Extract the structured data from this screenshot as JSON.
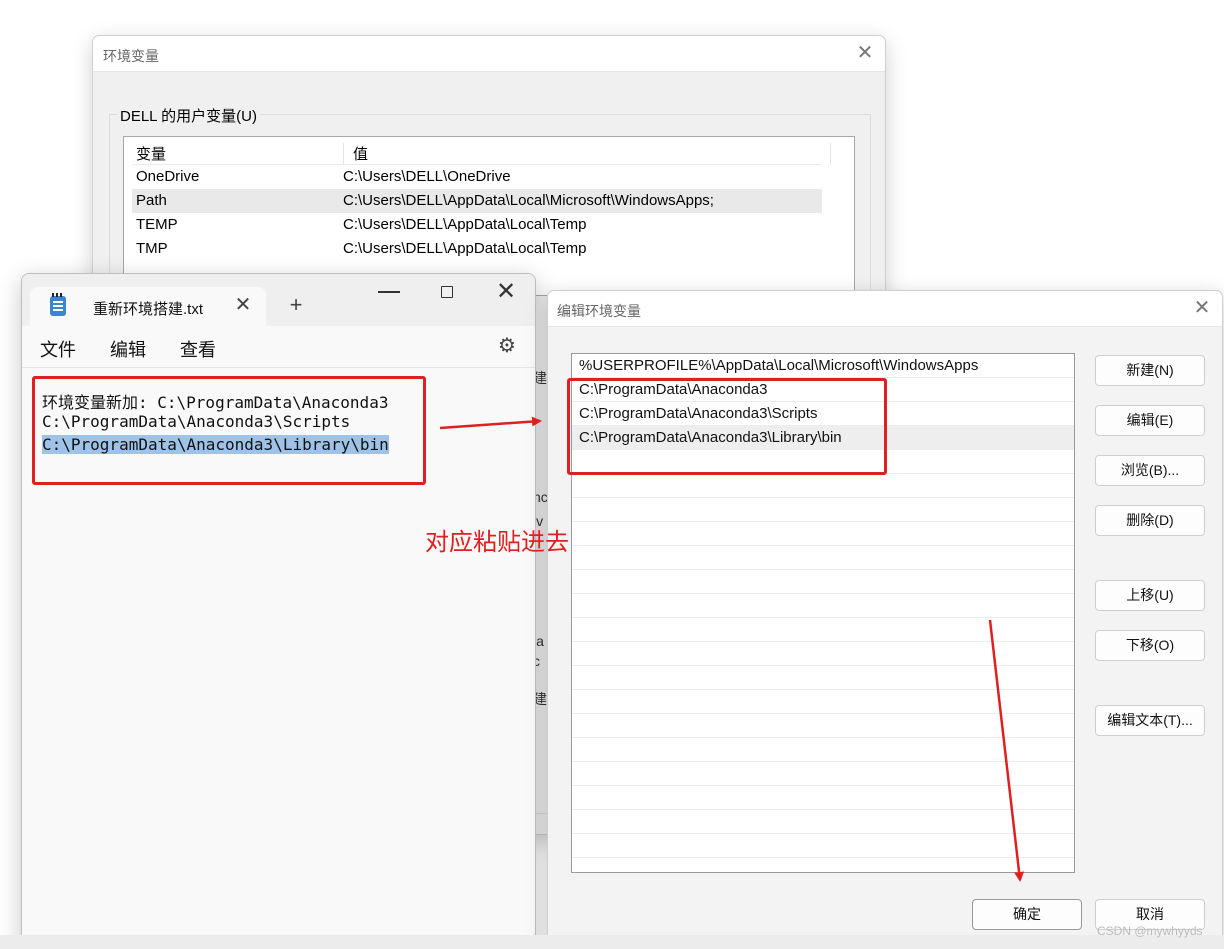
{
  "env_dialog": {
    "title": "环境变量",
    "user_group_label": "DELL 的用户变量(U)",
    "columns": [
      "变量",
      "值"
    ],
    "rows": [
      {
        "name": "OneDrive",
        "value": "C:\\Users\\DELL\\OneDrive"
      },
      {
        "name": "Path",
        "value": "C:\\Users\\DELL\\AppData\\Local\\Microsoft\\WindowsApps;"
      },
      {
        "name": "TEMP",
        "value": "C:\\Users\\DELL\\AppData\\Local\\Temp"
      },
      {
        "name": "TMP",
        "value": "C:\\Users\\DELL\\AppData\\Local\\Temp"
      }
    ],
    "peek_texts": [
      "建",
      "nc",
      "iv",
      "la",
      "c",
      "建"
    ]
  },
  "notepad": {
    "tab_title": "重新环境搭建.txt",
    "menu": [
      "文件",
      "编辑",
      "查看"
    ],
    "lines": [
      "环境变量新加: C:\\ProgramData\\Anaconda3",
      "C:\\ProgramData\\Anaconda3\\Scripts",
      "C:\\ProgramData\\Anaconda3\\Library\\bin"
    ]
  },
  "edit_dialog": {
    "title": "编辑环境变量",
    "entries": [
      "%USERPROFILE%\\AppData\\Local\\Microsoft\\WindowsApps",
      "C:\\ProgramData\\Anaconda3",
      "C:\\ProgramData\\Anaconda3\\Scripts",
      "C:\\ProgramData\\Anaconda3\\Library\\bin"
    ],
    "buttons": {
      "new": "新建(N)",
      "edit": "编辑(E)",
      "browse": "浏览(B)...",
      "delete": "删除(D)",
      "move_up": "上移(U)",
      "move_down": "下移(O)",
      "edit_text": "编辑文本(T)...",
      "ok": "确定",
      "cancel": "取消"
    }
  },
  "annotation": {
    "text": "对应粘贴进去",
    "color": "#e02020"
  },
  "watermark": "CSDN @mywhyyds"
}
